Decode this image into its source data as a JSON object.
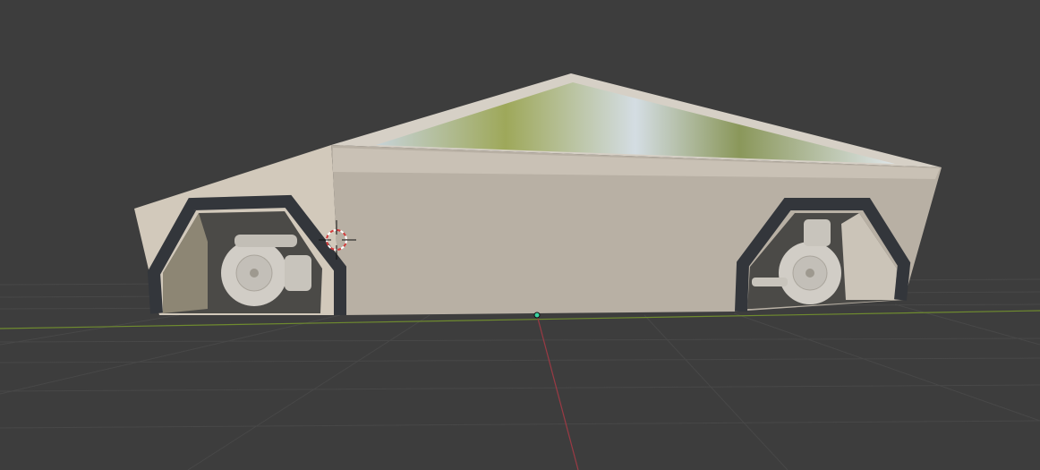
{
  "viewport": {
    "background_color": "#3d3d3d",
    "grid_color": "#4a4a4a",
    "x_axis_color": "#6f8b2f",
    "y_axis_color": "#9a3a44",
    "origin_color": "#3ad4a0"
  },
  "model": {
    "body_color": "#bdb5a9",
    "front_panel_color": "#d2c9bb",
    "wheel_arch_color": "#3a3d42",
    "wheel_color": "#cfcbc4"
  },
  "cursor": {
    "ring_color_a": "#d23b3b",
    "ring_color_b": "#ffffff"
  }
}
